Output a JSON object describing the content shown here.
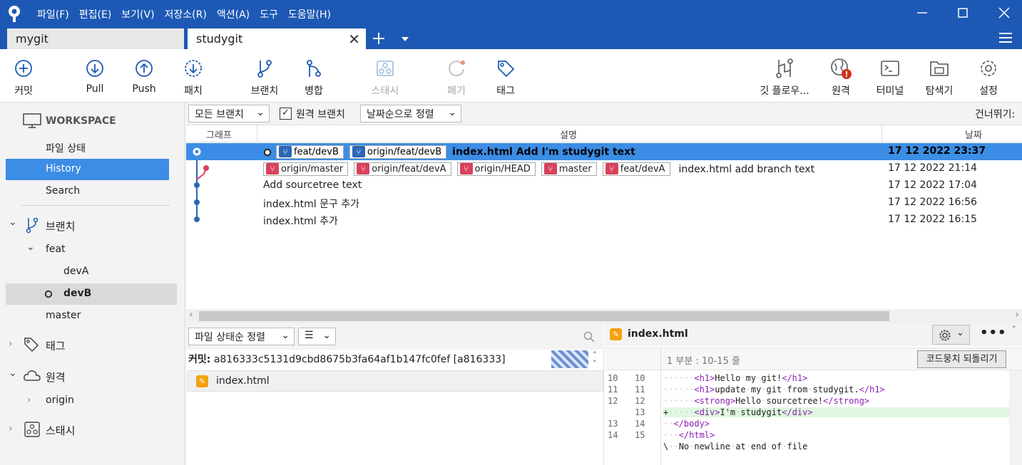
{
  "menu": [
    "파일(F)",
    "편집(E)",
    "보기(V)",
    "저장소(R)",
    "액션(A)",
    "도구",
    "도움말(H)"
  ],
  "tabs": [
    {
      "label": "mygit"
    },
    {
      "label": "studygit"
    }
  ],
  "toolbar": {
    "commit": "커밋",
    "pull": "Pull",
    "push": "Push",
    "patch": "패치",
    "branch": "브랜치",
    "merge": "병합",
    "stash": "스태시",
    "discard": "폐기",
    "tag": "태그",
    "gitflow": "깃 플로우...",
    "remote": "원격",
    "terminal": "터미널",
    "explorer": "탐색기",
    "settings": "설정"
  },
  "sidebar": {
    "workspace": "WORKSPACE",
    "file_status": "파일 상태",
    "history": "History",
    "search": "Search",
    "branches": "브랜치",
    "feat": "feat",
    "devA": "devA",
    "devB": "devB",
    "master": "master",
    "tags": "태그",
    "remotes": "원격",
    "origin": "origin",
    "stashes": "스태시"
  },
  "filter": {
    "all_branches": "모든 브랜치",
    "remote_branches": "원격 브랜치",
    "sort_date": "날짜순으로 정렬",
    "jump": "건너뛰기:"
  },
  "columns": {
    "graph": "그래프",
    "description": "설명",
    "date": "날짜"
  },
  "commits": [
    {
      "labels": [
        "feat/devB",
        "origin/feat/devB"
      ],
      "message": "index.html Add I'm studygit text",
      "date": "17 12 2022 23:37"
    },
    {
      "labels": [
        "origin/master",
        "origin/feat/devA",
        "origin/HEAD",
        "master",
        "feat/devA"
      ],
      "message": "index.html add branch text",
      "date": "17 12 2022 21:14"
    },
    {
      "labels": [],
      "message": "Add sourcetree text",
      "date": "17 12 2022 17:04"
    },
    {
      "labels": [],
      "message": "index.html 문구 추가",
      "date": "17 12 2022 16:56"
    },
    {
      "labels": [],
      "message": "index.html 추가",
      "date": "17 12 2022 16:15"
    }
  ],
  "files_panel": {
    "sort": "파일 상태순 정렬",
    "commit_label": "커밋:",
    "commit_hash": "a816333c5131d9cbd8675b3fa64af1b147fc0fef [a816333]",
    "file": "index.html"
  },
  "diff": {
    "file": "index.html",
    "hunk": "1 부분 : 10-15 줄",
    "revert": "코드뭉치 되돌리기",
    "lines": [
      {
        "n1": "10",
        "n2": "10",
        "text": "      <h1>Hello my git!</h1>"
      },
      {
        "n1": "11",
        "n2": "11",
        "text": "      <h1>update my git from studygit.</h1>"
      },
      {
        "n1": "12",
        "n2": "12",
        "text": "      <strong>Hello sourcetree!</strong>"
      },
      {
        "n1": "",
        "n2": "13",
        "text": "+     <div>I'm studygit</div>",
        "added": true
      },
      {
        "n1": "13",
        "n2": "14",
        "text": "  </body>"
      },
      {
        "n1": "14",
        "n2": "15",
        "text": "  </html>"
      },
      {
        "n1": "",
        "n2": "",
        "text": "\\  No newline at end of file"
      }
    ]
  }
}
